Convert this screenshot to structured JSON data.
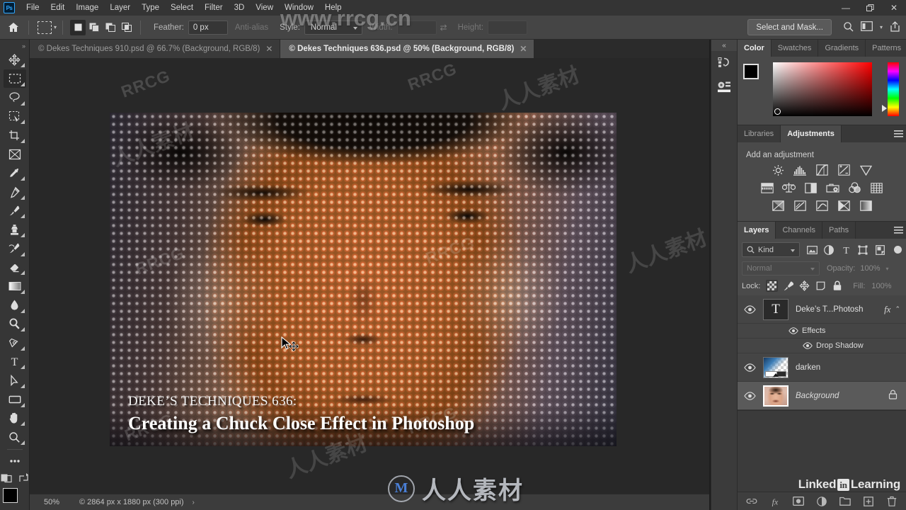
{
  "app": {
    "name": "Adobe Photoshop",
    "logo_text": "Ps"
  },
  "menubar": {
    "items": [
      {
        "label": "File"
      },
      {
        "label": "Edit"
      },
      {
        "label": "Image"
      },
      {
        "label": "Layer"
      },
      {
        "label": "Type"
      },
      {
        "label": "Select"
      },
      {
        "label": "Filter"
      },
      {
        "label": "3D"
      },
      {
        "label": "View"
      },
      {
        "label": "Window"
      },
      {
        "label": "Help"
      }
    ],
    "window_controls": {
      "minimize": "—",
      "restore": "❐",
      "close": "✕"
    }
  },
  "optionsbar": {
    "home_icon": "home-icon",
    "tool_preset_icon": "rectangular-marquee-icon",
    "selection_modes": [
      {
        "name": "new-selection",
        "active": true
      },
      {
        "name": "add-to-selection",
        "active": false
      },
      {
        "name": "subtract-from-selection",
        "active": false
      },
      {
        "name": "intersect-with-selection",
        "active": false
      }
    ],
    "feather_label": "Feather:",
    "feather_value": "0 px",
    "antialias_label": "Anti-alias",
    "style_label": "Style:",
    "style_value": "Normal",
    "width_label": "Width:",
    "width_value": "",
    "height_label": "Height:",
    "height_value": "",
    "select_and_mask_label": "Select and Mask...",
    "right_icons": [
      "search-icon",
      "workspace-icon",
      "chevron-down-icon",
      "share-icon"
    ]
  },
  "tabs": [
    {
      "label": "© Dekes Techniques 910.psd @ 66.7% (Background, RGB/8)",
      "active": false,
      "close": "✕"
    },
    {
      "label": "© Dekes Techniques 636.psd @ 50% (Background, RGB/8)",
      "active": true,
      "close": "✕"
    }
  ],
  "toolbar": {
    "collapse_label": "»",
    "tools": [
      {
        "name": "move-tool",
        "active": false
      },
      {
        "name": "rectangular-marquee-tool",
        "active": true
      },
      {
        "name": "lasso-tool",
        "active": false
      },
      {
        "name": "object-selection-tool",
        "active": false
      },
      {
        "name": "crop-tool",
        "active": false
      },
      {
        "name": "frame-tool",
        "active": false
      },
      {
        "name": "eyedropper-tool",
        "active": false
      },
      {
        "name": "spot-healing-brush-tool",
        "active": false
      },
      {
        "name": "brush-tool",
        "active": false
      },
      {
        "name": "clone-stamp-tool",
        "active": false
      },
      {
        "name": "history-brush-tool",
        "active": false
      },
      {
        "name": "eraser-tool",
        "active": false
      },
      {
        "name": "gradient-tool",
        "active": false
      },
      {
        "name": "blur-tool",
        "active": false
      },
      {
        "name": "dodge-tool",
        "active": false
      },
      {
        "name": "pen-tool",
        "active": false
      },
      {
        "name": "type-tool",
        "active": false
      },
      {
        "name": "path-selection-tool",
        "active": false
      },
      {
        "name": "rectangle-tool",
        "active": false
      },
      {
        "name": "hand-tool",
        "active": false
      },
      {
        "name": "zoom-tool",
        "active": false
      },
      {
        "name": "edit-toolbar-tool",
        "active": false
      }
    ],
    "quickmask_icon": "quick-mask-icon",
    "screenmode_icon": "screen-mode-icon",
    "foreground_color": "#000000",
    "background_color": "#ffffff"
  },
  "canvas": {
    "document_title_small": "DEKE’S TECHNIQUES 636:",
    "document_title_large": "Creating a Chuck Close Effect in Photoshop",
    "cursor": "move-cursor"
  },
  "statusbar": {
    "zoom": "50%",
    "dimensions": "© 2864 px x 1880 px (300 ppi)",
    "arrow": "›"
  },
  "rail": {
    "collapse_label": "«",
    "icons": [
      "history-icon",
      "actions-icon"
    ]
  },
  "color_panel": {
    "tabs": [
      {
        "label": "Color",
        "active": true
      },
      {
        "label": "Swatches",
        "active": false
      },
      {
        "label": "Gradients",
        "active": false
      },
      {
        "label": "Patterns",
        "active": false
      }
    ],
    "menu_icon": "panel-menu-icon",
    "foreground": "#000000",
    "background": "#ffffff",
    "hue": "#ff0000"
  },
  "adjustments_panel": {
    "tabs": [
      {
        "label": "Libraries",
        "active": false
      },
      {
        "label": "Adjustments",
        "active": true
      }
    ],
    "menu_icon": "panel-menu-icon",
    "heading": "Add an adjustment",
    "rows": [
      [
        "brightness-contrast-icon",
        "levels-icon",
        "curves-icon",
        "exposure-icon",
        "vibrance-icon"
      ],
      [
        "hue-saturation-icon",
        "color-balance-icon",
        "black-white-icon",
        "photo-filter-icon",
        "channel-mixer-icon",
        "color-lookup-icon"
      ],
      [
        "invert-icon",
        "posterize-icon",
        "threshold-icon",
        "selective-color-icon",
        "gradient-map-icon"
      ]
    ]
  },
  "layers_panel": {
    "tabs": [
      {
        "label": "Layers",
        "active": true
      },
      {
        "label": "Channels",
        "active": false
      },
      {
        "label": "Paths",
        "active": false
      }
    ],
    "menu_icon": "panel-menu-icon",
    "filter_kind_label": "Kind",
    "filter_icons": [
      "filter-pixel-icon",
      "filter-adjustment-icon",
      "filter-type-icon",
      "filter-shape-icon",
      "filter-smart-object-icon"
    ],
    "filter_toggle": "filter-toggle",
    "blend_mode": "Normal",
    "opacity_label": "Opacity:",
    "opacity_value": "100%",
    "lock_label": "Lock:",
    "lock_buttons": [
      "lock-transparent-pixels",
      "lock-image-pixels",
      "lock-position",
      "lock-artboard-nesting",
      "lock-all"
    ],
    "fill_label": "Fill:",
    "fill_value": "100%",
    "layers": [
      {
        "name": "Deke’s T...Photosh",
        "type": "text",
        "visible": true,
        "thumb": "T",
        "fx_label": "fx",
        "caret": "⌃",
        "selected": false,
        "effects": [
          {
            "label": "Effects",
            "visible": true
          },
          {
            "label": "Drop Shadow",
            "visible": true
          }
        ]
      },
      {
        "name": "darken",
        "type": "gradient-mask",
        "visible": true,
        "selected": false
      },
      {
        "name": "Background",
        "type": "image",
        "visible": true,
        "selected": true,
        "locked": true
      }
    ],
    "bottom_icons": [
      "link-layers-icon",
      "layer-style-icon",
      "layer-mask-icon",
      "new-adjustment-layer-icon",
      "new-group-icon",
      "new-layer-icon",
      "delete-layer-icon"
    ]
  },
  "branding": {
    "linkedin_prefix": "Linked",
    "linkedin_badge": "in",
    "linkedin_suffix": "Learning"
  },
  "watermarks": {
    "url": "www.rrcg.cn",
    "rrcg": "RRCG",
    "chinese": "人人素材",
    "logo_letter": "M"
  }
}
